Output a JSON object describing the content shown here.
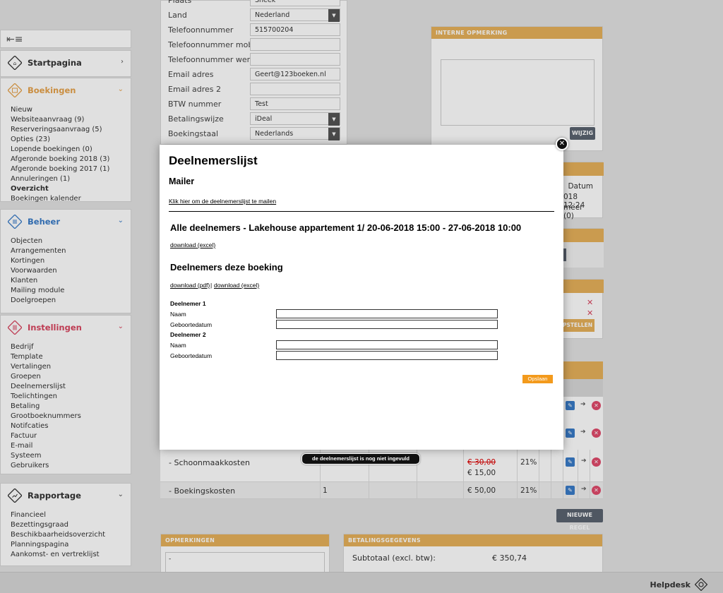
{
  "sidebar": {
    "toggle_icon": "menu-collapse-icon",
    "sections": [
      {
        "key": "startpagina",
        "label": "Startpagina",
        "icon": "home-icon",
        "color": "#333333",
        "items": []
      },
      {
        "key": "boekingen",
        "label": "Boekingen",
        "icon": "calendar-icon",
        "color": "#e6a24a",
        "items": [
          "Nieuw",
          "Websiteaanvraag (9)",
          "Reserveringsaanvraag (5)",
          "Opties (23)",
          "Lopende boekingen (0)",
          "Afgeronde boeking 2018 (3)",
          "Afgeronde boeking 2017 (1)",
          "Annuleringen (1)",
          "Overzicht",
          "Boekingen kalender"
        ],
        "active": "Overzicht"
      },
      {
        "key": "beheer",
        "label": "Beheer",
        "icon": "list-icon",
        "color": "#3a7cc8",
        "items": [
          "Objecten",
          "Arrangementen",
          "Kortingen",
          "Voorwaarden",
          "Klanten",
          "Mailing module",
          "Doelgroepen"
        ]
      },
      {
        "key": "instellingen",
        "label": "Instellingen",
        "icon": "sliders-icon",
        "color": "#d9455f",
        "items": [
          "Bedrijf",
          "Template",
          "Vertalingen",
          "Groepen",
          "Deelnemerslijst",
          "Toelichtingen",
          "Betaling",
          "Grootboeknummers",
          "Notifcaties",
          "Factuur",
          "E-mail",
          "Systeem",
          "Gebruikers"
        ]
      },
      {
        "key": "rapportage",
        "label": "Rapportage",
        "icon": "chart-icon",
        "color": "#333333",
        "items": [
          "Financieel",
          "Bezettingsgraad",
          "Beschikbaarheidsoverzicht",
          "Planningspagina",
          "Aankomst- en vertreklijst"
        ]
      }
    ]
  },
  "form": {
    "rows": [
      {
        "label": "Plaats",
        "value": "Sneek",
        "select": false
      },
      {
        "label": "Land",
        "value": "Nederland",
        "select": true
      },
      {
        "label": "Telefoonnummer",
        "value": "515700204",
        "select": false
      },
      {
        "label": "Telefoonnummer mobiel",
        "value": "",
        "select": false
      },
      {
        "label": "Telefoonnummer werk",
        "value": "",
        "select": false
      },
      {
        "label": "Email adres",
        "value": "Geert@123boeken.nl",
        "select": false
      },
      {
        "label": "Email adres 2",
        "value": "",
        "select": false
      },
      {
        "label": "BTW nummer",
        "value": "Test",
        "select": false
      },
      {
        "label": "Betalingswijze",
        "value": "iDeal",
        "select": true
      },
      {
        "label": "Boekingstaal",
        "value": "Nederlands",
        "select": true
      }
    ]
  },
  "interne": {
    "title": "INTERNE OPMERKING",
    "button": "WIJZIG"
  },
  "info_panel": {
    "datum": "Datum",
    "time": "018 12:24",
    "meer": "meer (0)"
  },
  "opstellen": "PSTELLEN",
  "rows": [
    {
      "name": "- Schoonmaakkosten",
      "qty": "",
      "price_old": "€ 30,00",
      "price": "€ 15,00",
      "vat": "21%"
    },
    {
      "name": "- Boekingskosten",
      "qty": "1",
      "price_old": "",
      "price": "€ 50,00",
      "vat": "21%"
    }
  ],
  "nieuwe_regel": "NIEUWE REGEL",
  "opmerkingen": {
    "title": "OPMERKINGEN",
    "value": "-"
  },
  "betaling": {
    "title": "BETALINGSGEGEVENS",
    "subtotal_label": "Subtotaal (excl. btw):",
    "subtotal_value": "€ 350,74"
  },
  "modal": {
    "title": "Deelnemerslijst",
    "mailer": "Mailer",
    "mail_link": "Klik hier om de deelnemerslijst te mailen",
    "all_heading": "Alle deelnemers - Lakehouse appartement 1/ 20-06-2018 15:00 - 27-06-2018 10:00",
    "dl_excel": "download (excel)",
    "this_heading": "Deelnemers deze boeking",
    "dl_pdf": "download (pdf)",
    "sep": "|",
    "participants": [
      {
        "label": "Deelnemer 1",
        "naam": "Naam",
        "geb": "Geboortedatum"
      },
      {
        "label": "Deelnemer 2",
        "naam": "Naam",
        "geb": "Geboortedatum"
      }
    ],
    "save": "Opslaan",
    "close_icon": "close-icon"
  },
  "tooltip": "de deelnemerslijst is nog niet ingevuld",
  "footer": {
    "helpdesk": "Helpdesk",
    "icon": "lifebuoy-icon"
  }
}
